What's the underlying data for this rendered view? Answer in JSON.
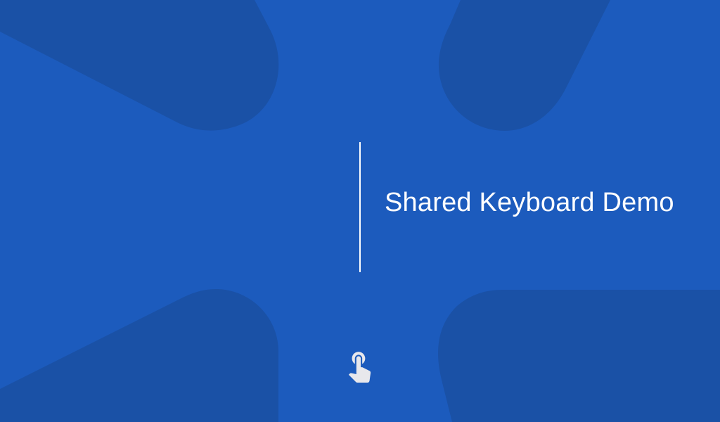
{
  "screen": {
    "title": "Shared Keyboard Demo"
  },
  "icons": {
    "touch": "touch-app-icon"
  },
  "colors": {
    "background": "#1c5bbd",
    "shape": "#1a51a6",
    "text": "#ffffff",
    "divider": "#ffffff",
    "icon": "#e8e8ec"
  }
}
